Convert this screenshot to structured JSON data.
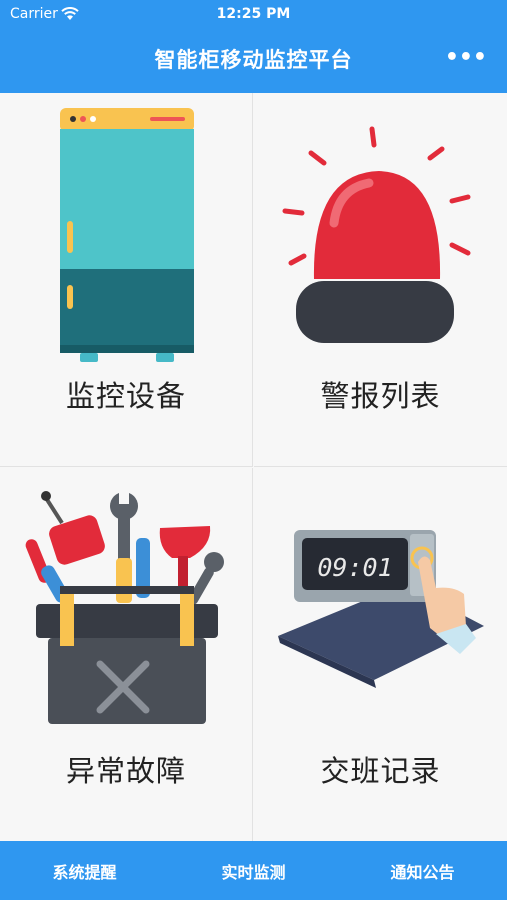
{
  "status_bar": {
    "carrier": "Carrier",
    "time": "12:25 PM"
  },
  "header": {
    "title": "智能柜移动监控平台",
    "more_icon": "more-dots-icon"
  },
  "tiles": [
    {
      "label": "监控设备",
      "icon": "cabinet-icon"
    },
    {
      "label": "警报列表",
      "icon": "alarm-light-icon"
    },
    {
      "label": "异常故障",
      "icon": "toolbox-icon"
    },
    {
      "label": "交班记录",
      "icon": "time-clock-icon",
      "clock_text": "09:01"
    }
  ],
  "tabbar": {
    "items": [
      {
        "label": "系统提醒"
      },
      {
        "label": "实时监测"
      },
      {
        "label": "通知公告"
      }
    ]
  },
  "colors": {
    "accent": "#2f97f0"
  }
}
